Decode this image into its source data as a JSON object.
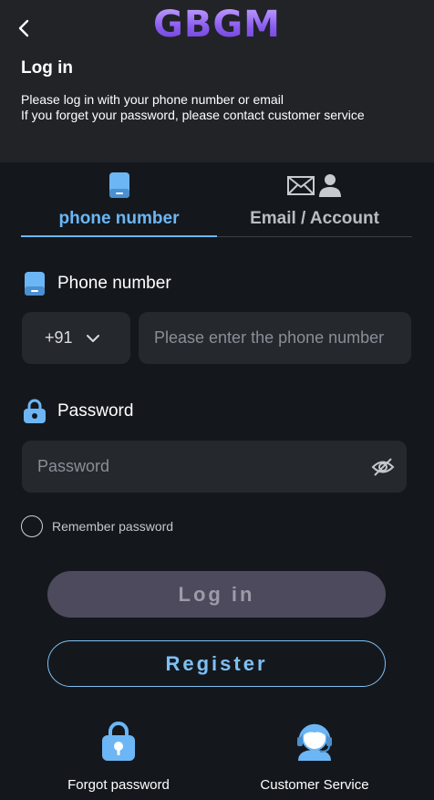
{
  "header": {
    "logo": "GBGM",
    "title": "Log in",
    "intro_line1": "Please log in with your phone number or email",
    "intro_line2": "If you forget your password, please contact customer service"
  },
  "tabs": [
    {
      "label": "phone number",
      "icon": "phone-icon",
      "active": true
    },
    {
      "label": "Email / Account",
      "icon": "mail-user-icon",
      "active": false
    }
  ],
  "phone": {
    "label": "Phone number",
    "country_code": "+91",
    "placeholder": "Please enter the phone number",
    "value": ""
  },
  "password": {
    "label": "Password",
    "placeholder": "Password",
    "value": ""
  },
  "remember": {
    "label": "Remember password",
    "checked": false
  },
  "buttons": {
    "login": "Log in",
    "register": "Register"
  },
  "bottom": {
    "forgot": "Forgot password",
    "service": "Customer Service"
  },
  "colors": {
    "accent": "#6cb6f5",
    "background": "#14181d",
    "header_bg": "#212327",
    "input_bg": "#25282d",
    "login_btn": "#4c4a5c"
  }
}
